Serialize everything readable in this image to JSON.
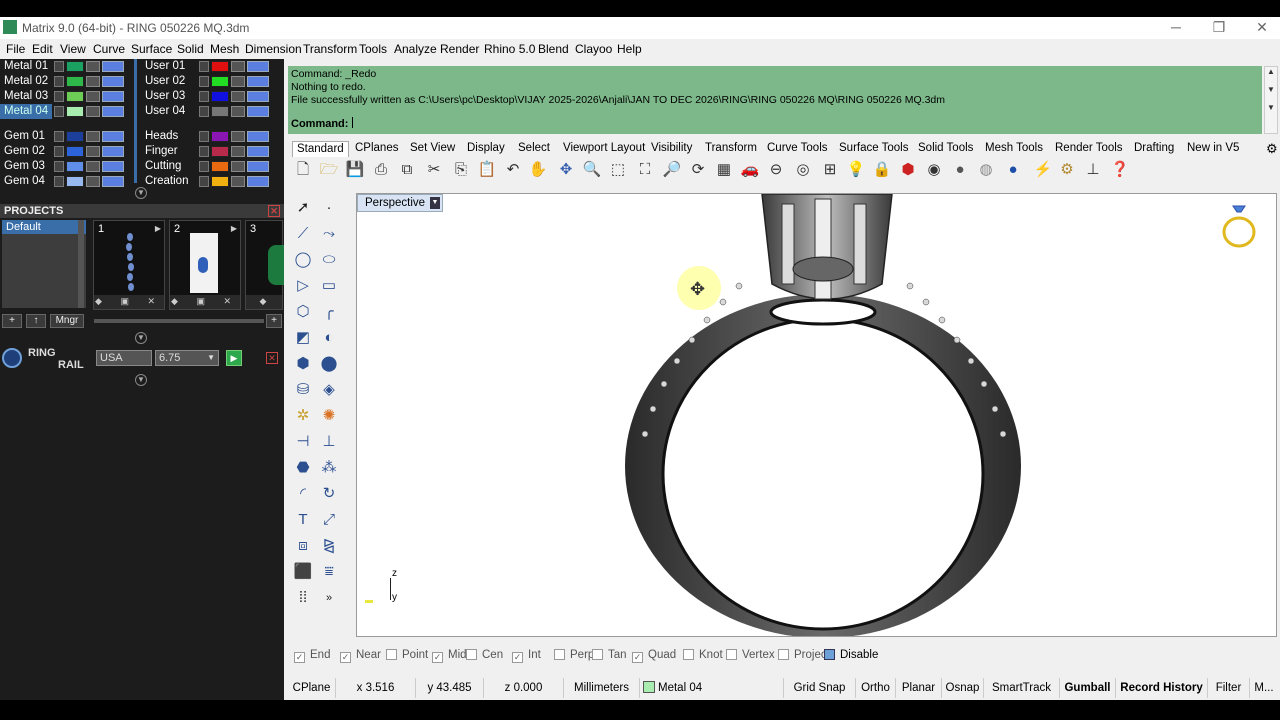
{
  "window": {
    "title": "Matrix 9.0 (64-bit) - RING 050226 MQ.3dm",
    "minimize": "─",
    "restore": "❐",
    "close": "✕"
  },
  "menu": [
    "File",
    "Edit",
    "View",
    "Curve",
    "Surface",
    "Solid",
    "Mesh",
    "Dimension",
    "Transform",
    "Tools",
    "Analyze",
    "Render",
    "Rhino 5.0",
    "Blend",
    "Clayoo",
    "Help"
  ],
  "layers_left": [
    {
      "name": "Metal 01",
      "color": "#1aa060"
    },
    {
      "name": "Metal 02",
      "color": "#2fb84a"
    },
    {
      "name": "Metal 03",
      "color": "#6ccc55"
    },
    {
      "name": "Metal 04",
      "color": "#a8ecb0"
    },
    {
      "name": "Gem 01",
      "color": "#1d3f9c"
    },
    {
      "name": "Gem 02",
      "color": "#2d63d8"
    },
    {
      "name": "Gem 03",
      "color": "#5f8ee8"
    },
    {
      "name": "Gem 04",
      "color": "#98b8f0"
    }
  ],
  "layers_right": [
    {
      "name": "User 01",
      "color": "#e01010"
    },
    {
      "name": "User 02",
      "color": "#22dd22"
    },
    {
      "name": "User 03",
      "color": "#1010e0"
    },
    {
      "name": "User 04",
      "color": "#777777"
    },
    {
      "name": "Heads",
      "color": "#8a16b4"
    },
    {
      "name": "Finger",
      "color": "#b82a4a"
    },
    {
      "name": "Cutting",
      "color": "#e86a10"
    },
    {
      "name": "Creation",
      "color": "#f0b010"
    }
  ],
  "selected_layer": "Metal 04",
  "projects": {
    "header": "PROJECTS",
    "list": [
      "Default"
    ],
    "thumbs": [
      "1",
      "2",
      "3"
    ],
    "thumb_tools": "◆ ▣ ✕",
    "tools": [
      "+",
      "↑",
      "Mngr",
      "+"
    ]
  },
  "ring": {
    "label1": "RING",
    "label2": "RAIL",
    "region": "USA",
    "size": "6.75"
  },
  "command": {
    "lines": [
      "Command: _Redo",
      "Nothing to redo.",
      "File successfully written as C:\\Users\\pc\\Desktop\\VIJAY 2025-2026\\Anjali\\JAN TO DEC 2026\\RING\\RING 050226 MQ\\RING 050226 MQ.3dm"
    ],
    "prompt": "Command:"
  },
  "tabs": [
    "Standard",
    "CPlanes",
    "Set View",
    "Display",
    "Select",
    "Viewport Layout",
    "Visibility",
    "Transform",
    "Curve Tools",
    "Surface Tools",
    "Solid Tools",
    "Mesh Tools",
    "Render Tools",
    "Drafting",
    "New in V5"
  ],
  "toolbar_icons": [
    "new-icon",
    "open-icon",
    "save-icon",
    "print-icon",
    "import-icon",
    "cut-icon",
    "copy-icon",
    "paste-icon",
    "undo-icon",
    "pan-icon",
    "rotate-icon",
    "zoom-icon",
    "zoom-window-icon",
    "zoom-extents-icon",
    "zoom-selected-icon",
    "rotate-view-icon",
    "four-view-icon",
    "car-icon",
    "light-icon",
    "circle-icon",
    "grid-icon",
    "bulb-icon",
    "lock-icon",
    "material-icon",
    "color-wheel-icon",
    "sphere-icon",
    "shaded-icon",
    "rendered-icon",
    "flash-icon",
    "gear-icon",
    "dimension-icon",
    "help-icon"
  ],
  "viewport": {
    "label": "Perspective",
    "axis_z": "z",
    "axis_y": "y"
  },
  "osnaps": [
    {
      "label": "End",
      "checked": true
    },
    {
      "label": "Near",
      "checked": true
    },
    {
      "label": "Point",
      "checked": false
    },
    {
      "label": "Mid",
      "checked": true
    },
    {
      "label": "Cen",
      "checked": false
    },
    {
      "label": "Int",
      "checked": true
    },
    {
      "label": "Perp",
      "checked": false
    },
    {
      "label": "Tan",
      "checked": false
    },
    {
      "label": "Quad",
      "checked": true
    },
    {
      "label": "Knot",
      "checked": false
    },
    {
      "label": "Vertex",
      "checked": false
    },
    {
      "label": "Project",
      "checked": false
    },
    {
      "label": "Disable",
      "checked": false
    }
  ],
  "status": {
    "cplane": "CPlane",
    "x": "x 3.516",
    "y": "y 43.485",
    "z": "z 0.000",
    "units": "Millimeters",
    "layer": "Metal 04",
    "grid_snap": "Grid Snap",
    "ortho": "Ortho",
    "planar": "Planar",
    "osnap": "Osnap",
    "smarttrack": "SmartTrack",
    "gumball": "Gumball",
    "record": "Record History",
    "filter": "Filter",
    "more": "M..."
  }
}
